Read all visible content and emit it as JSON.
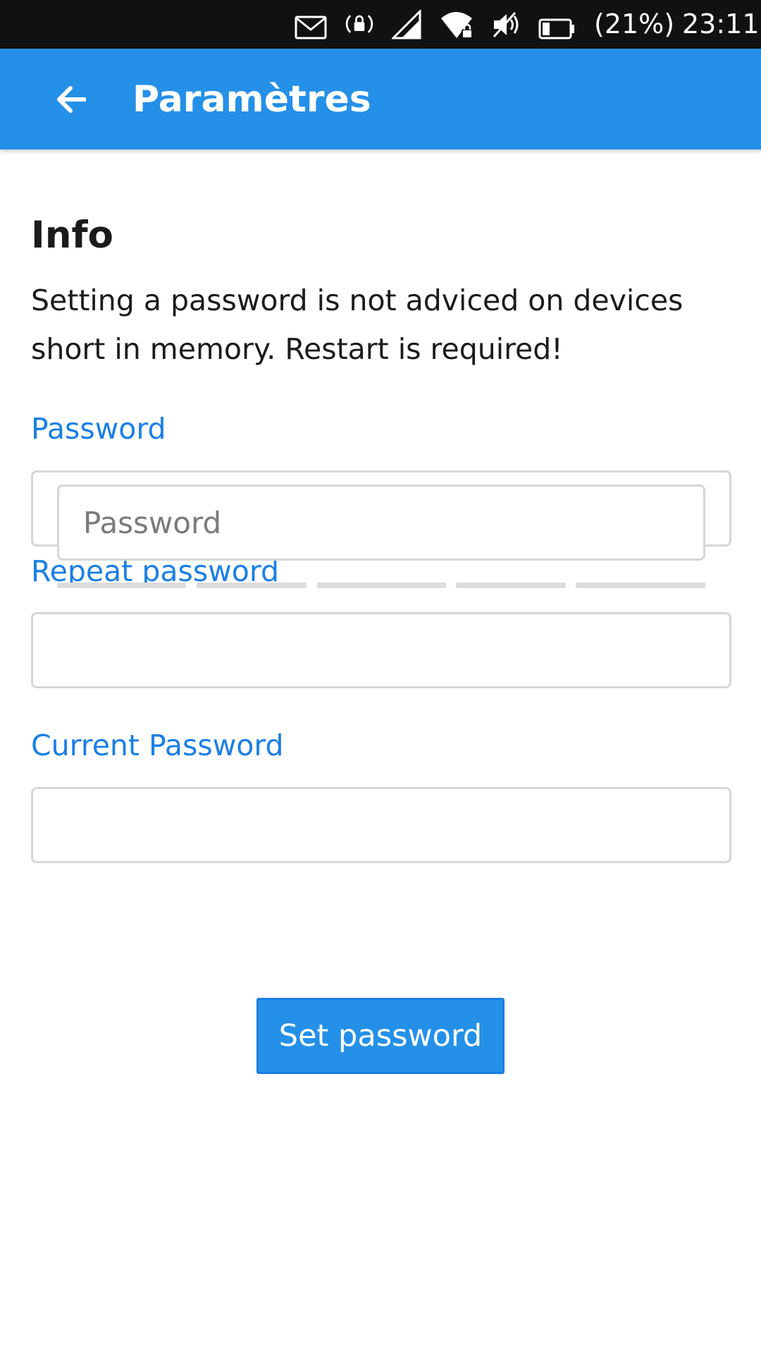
{
  "status_bar": {
    "icons": [
      "mail-icon",
      "screen-rotation-lock-icon",
      "cell-signal-icon",
      "wifi-lock-icon",
      "mute-icon",
      "battery-icon"
    ],
    "battery": "(21%)",
    "time": "23:11"
  },
  "header": {
    "back_icon": "arrow-left-icon",
    "title": "Paramètres"
  },
  "info": {
    "heading": "Info",
    "text": "Setting a password is not adviced on devices short in memory. Restart is required!"
  },
  "form": {
    "password_label": "Password",
    "popup_placeholder": "Password",
    "strength_level": 0,
    "repeat_password_label": "Repeat password",
    "current_password_label": "Current Password",
    "submit_label": "Set password"
  },
  "colors": {
    "accent": "#2490e8",
    "label": "#1a7fe6",
    "status_bar": "#111111",
    "input_border": "#d4d6d9",
    "meter_empty": "#dcdcdc"
  }
}
